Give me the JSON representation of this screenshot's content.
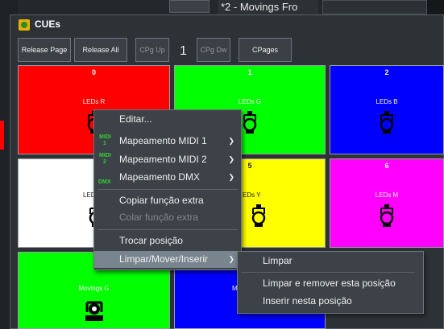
{
  "background": {
    "tab_title": "*2 - Movings Fro"
  },
  "window": {
    "title": "CUEs"
  },
  "toolbar": {
    "release_page": "Release Page",
    "release_all": "Release All",
    "cpg_up": "CPg Up",
    "page_number": "1",
    "cpg_dw": "CPg Dw",
    "cpages": "CPages"
  },
  "cues": [
    {
      "num": "0",
      "label": "LEDs R",
      "color": "#ff0000"
    },
    {
      "num": "1",
      "label": "LEDs G",
      "color": "#00ff00"
    },
    {
      "num": "2",
      "label": "LEDs B",
      "color": "#0000ff"
    },
    {
      "num": "",
      "label": "LED",
      "color": "#ffffff"
    },
    {
      "num": "5",
      "label": "EDs Y",
      "color": "#ffff00"
    },
    {
      "num": "6",
      "label": "LEDs M",
      "color": "#ff00ff"
    },
    {
      "num": "",
      "label": "Movings G",
      "color": "#00ff00"
    },
    {
      "num": "",
      "label": "M",
      "color": "#0000ff"
    }
  ],
  "context_menu": {
    "items": [
      {
        "label": "Editar...",
        "disabled": false,
        "submenu": false
      },
      {
        "label": "Mapeamento MIDI 1",
        "disabled": false,
        "submenu": true,
        "icon": "midi-1-icon",
        "icon_text": [
          "MIDI",
          "1"
        ]
      },
      {
        "label": "Mapeamento MIDI 2",
        "disabled": false,
        "submenu": true,
        "icon": "midi-2-icon",
        "icon_text": [
          "MIDI",
          "2"
        ]
      },
      {
        "label": "Mapeamento DMX",
        "disabled": false,
        "submenu": true,
        "icon": "dmx-icon",
        "icon_text": [
          "DMX"
        ]
      },
      {
        "label": "Copiar função extra",
        "disabled": false,
        "submenu": false
      },
      {
        "label": "Colar função extra",
        "disabled": true,
        "submenu": false
      },
      {
        "label": "Trocar posição",
        "disabled": false,
        "submenu": false
      },
      {
        "label": "Limpar/Mover/Inserir",
        "disabled": false,
        "submenu": true,
        "highlighted": true
      }
    ]
  },
  "submenu": {
    "items": [
      {
        "label": "Limpar"
      },
      {
        "label": "Limpar e remover esta posição"
      },
      {
        "label": "Inserir nesta posição"
      }
    ]
  },
  "colors": {
    "window_bg": "#2d3237",
    "menu_bg": "#3c4248",
    "menu_highlight": "#78858f",
    "midi_green": "#32d032"
  }
}
